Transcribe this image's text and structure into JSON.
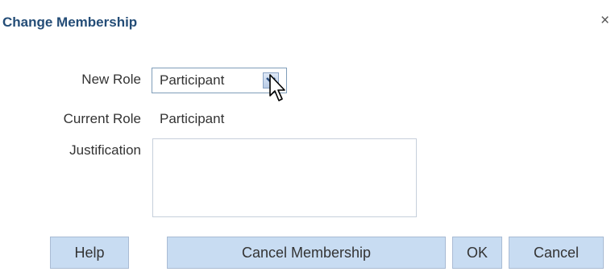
{
  "dialog": {
    "title": "Change Membership",
    "close_glyph": "×"
  },
  "form": {
    "new_role_label": "New Role",
    "new_role_value": "Participant",
    "current_role_label": "Current Role",
    "current_role_value": "Participant",
    "justification_label": "Justification",
    "justification_value": ""
  },
  "buttons": {
    "help": "Help",
    "cancel_membership": "Cancel Membership",
    "ok": "OK",
    "cancel": "Cancel"
  },
  "icons": {
    "dropdown": "chevron-down-icon",
    "close": "close-icon",
    "cursor": "mouse-pointer-icon"
  },
  "colors": {
    "title": "#244d77",
    "button_bg": "#c8dcf2",
    "button_border": "#a9bbd4",
    "field_border": "#7f9db9"
  }
}
